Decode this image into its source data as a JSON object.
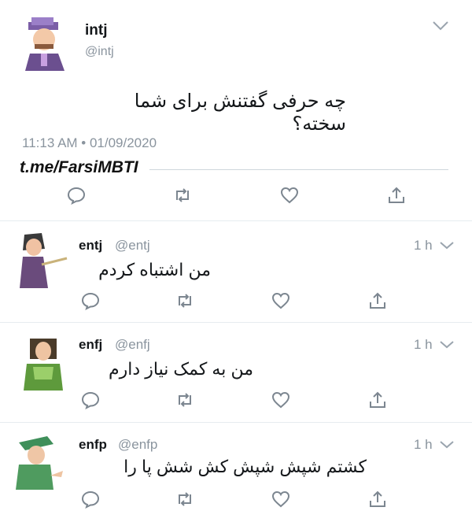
{
  "main_tweet": {
    "name": "intj",
    "handle": "@intj",
    "text": "چه حرفی گفتنش برای شما سخته؟",
    "timestamp": "11:13 AM • 01/09/2020",
    "watermark": "t.me/FarsiMBTI"
  },
  "replies": [
    {
      "name": "entj",
      "handle": "@entj",
      "time": "1 h",
      "text": "من اشتباه کردم"
    },
    {
      "name": "enfj",
      "handle": "@enfj",
      "time": "1 h",
      "text": "من به کمک نیاز دارم"
    },
    {
      "name": "enfp",
      "handle": "@enfp",
      "time": "1 h",
      "text": "کشتم شپش شپش کش شش پا را"
    }
  ],
  "icons": [
    "reply-icon",
    "retweet-icon",
    "like-icon",
    "share-icon",
    "chevron-down-icon"
  ],
  "colors": {
    "text": "#14171a",
    "muted": "#8a949e",
    "icon": "#7c8690",
    "divider": "#e6ecf0"
  }
}
